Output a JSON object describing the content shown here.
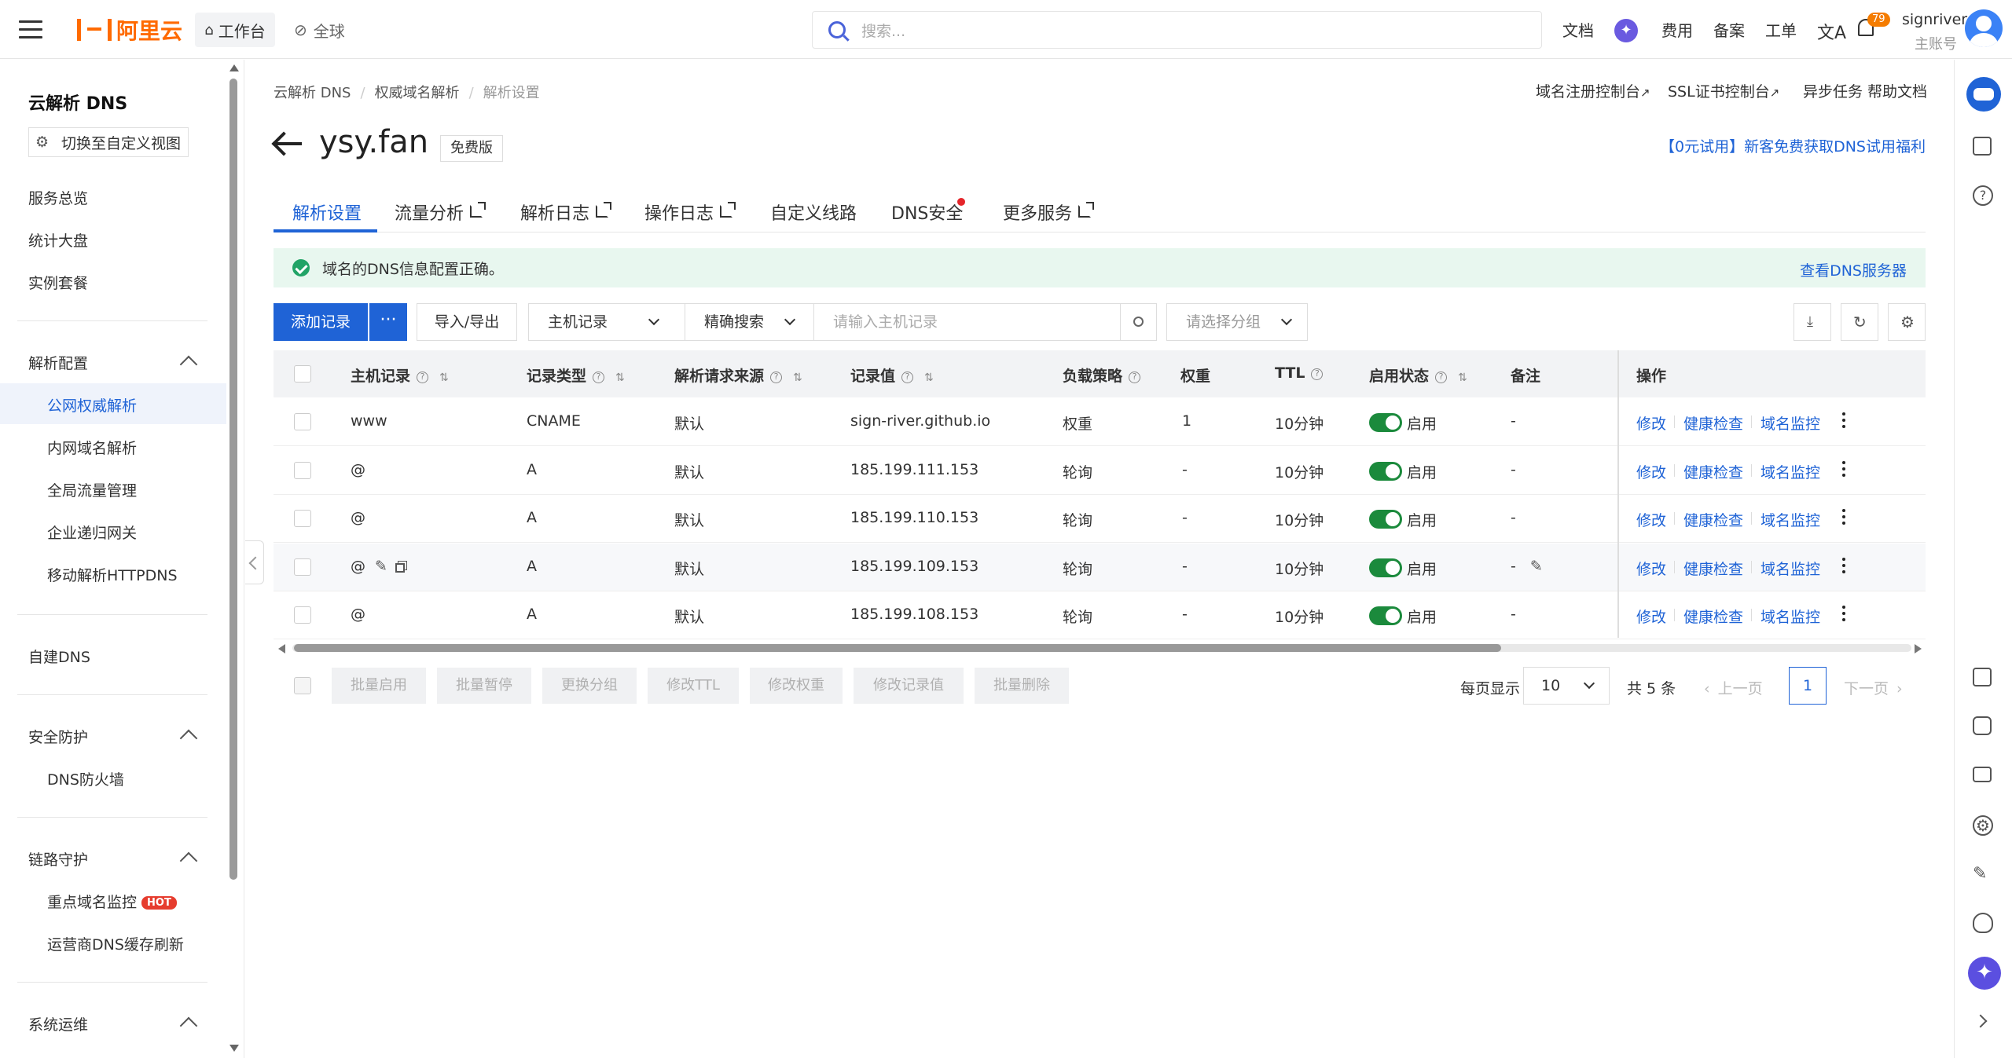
{
  "topbar": {
    "logo_text": "阿里云",
    "workbench": "工作台",
    "global": "全球",
    "search_placeholder": "搜索...",
    "links": [
      "文档",
      "费用",
      "备案",
      "工单"
    ],
    "notification_count": "79",
    "user_name": "signriver",
    "user_role": "主账号"
  },
  "sidebar": {
    "title": "云解析 DNS",
    "switch_view": "切换至自定义视图",
    "top_items": [
      "服务总览",
      "统计大盘",
      "实例套餐"
    ],
    "groups": [
      {
        "label": "解析配置",
        "items": [
          "公网权威解析",
          "内网域名解析",
          "全局流量管理",
          "企业递归网关",
          "移动解析HTTPDNS"
        ]
      },
      {
        "label": "自建DNS"
      },
      {
        "label": "安全防护",
        "items": [
          "DNS防火墙"
        ]
      },
      {
        "label": "链路守护",
        "items": [
          "重点域名监控",
          "运营商DNS缓存刷新"
        ]
      },
      {
        "label": "系统运维"
      }
    ],
    "hot_badge": "HOT",
    "active_item": "公网权威解析"
  },
  "breadcrumb": [
    "云解析 DNS",
    "权威域名解析",
    "解析设置"
  ],
  "header_links": [
    "域名注册控制台",
    "SSL证书控制台",
    "异步任务",
    "帮助文档"
  ],
  "domain": {
    "name": "ysy.fan",
    "edition": "免费版"
  },
  "promo": "【0元试用】新客免费获取DNS试用福利",
  "tabs": [
    "解析设置",
    "流量分析",
    "解析日志",
    "操作日志",
    "自定义线路",
    "DNS安全",
    "更多服务"
  ],
  "notice": {
    "text": "域名的DNS信息配置正确。",
    "link": "查看DNS服务器"
  },
  "toolbar": {
    "add_record": "添加记录",
    "more": "···",
    "import_export": "导入/导出",
    "field_select": "主机记录",
    "match_select": "精确搜索",
    "search_placeholder": "请输入主机记录",
    "group_select": "请选择分组"
  },
  "table": {
    "headers": [
      "主机记录",
      "记录类型",
      "解析请求来源",
      "记录值",
      "负载策略",
      "权重",
      "TTL",
      "启用状态",
      "备注",
      "操作"
    ],
    "rows": [
      {
        "host": "www",
        "type": "CNAME",
        "source": "默认",
        "value": "sign-river.github.io",
        "policy": "权重",
        "weight": "1",
        "ttl": "10分钟",
        "status": "启用",
        "remark": "-"
      },
      {
        "host": "@",
        "type": "A",
        "source": "默认",
        "value": "185.199.111.153",
        "policy": "轮询",
        "weight": "-",
        "ttl": "10分钟",
        "status": "启用",
        "remark": "-"
      },
      {
        "host": "@",
        "type": "A",
        "source": "默认",
        "value": "185.199.110.153",
        "policy": "轮询",
        "weight": "-",
        "ttl": "10分钟",
        "status": "启用",
        "remark": "-"
      },
      {
        "host": "@",
        "type": "A",
        "source": "默认",
        "value": "185.199.109.153",
        "policy": "轮询",
        "weight": "-",
        "ttl": "10分钟",
        "status": "启用",
        "remark": "-"
      },
      {
        "host": "@",
        "type": "A",
        "source": "默认",
        "value": "185.199.108.153",
        "policy": "轮询",
        "weight": "-",
        "ttl": "10分钟",
        "status": "启用",
        "remark": "-"
      }
    ],
    "actions": [
      "修改",
      "健康检查",
      "域名监控"
    ]
  },
  "bulk_actions": [
    "批量启用",
    "批量暂停",
    "更换分组",
    "修改TTL",
    "修改权重",
    "修改记录值",
    "批量删除"
  ],
  "pagination": {
    "per_page_label": "每页显示",
    "per_page": "10",
    "total": "共 5 条",
    "prev": "上一页",
    "current": "1",
    "next": "下一页"
  },
  "colors": {
    "primary": "#1f63d6",
    "brand": "#ff6a00",
    "success": "#1b8a3c",
    "notice_bg": "#e8f7ef"
  }
}
